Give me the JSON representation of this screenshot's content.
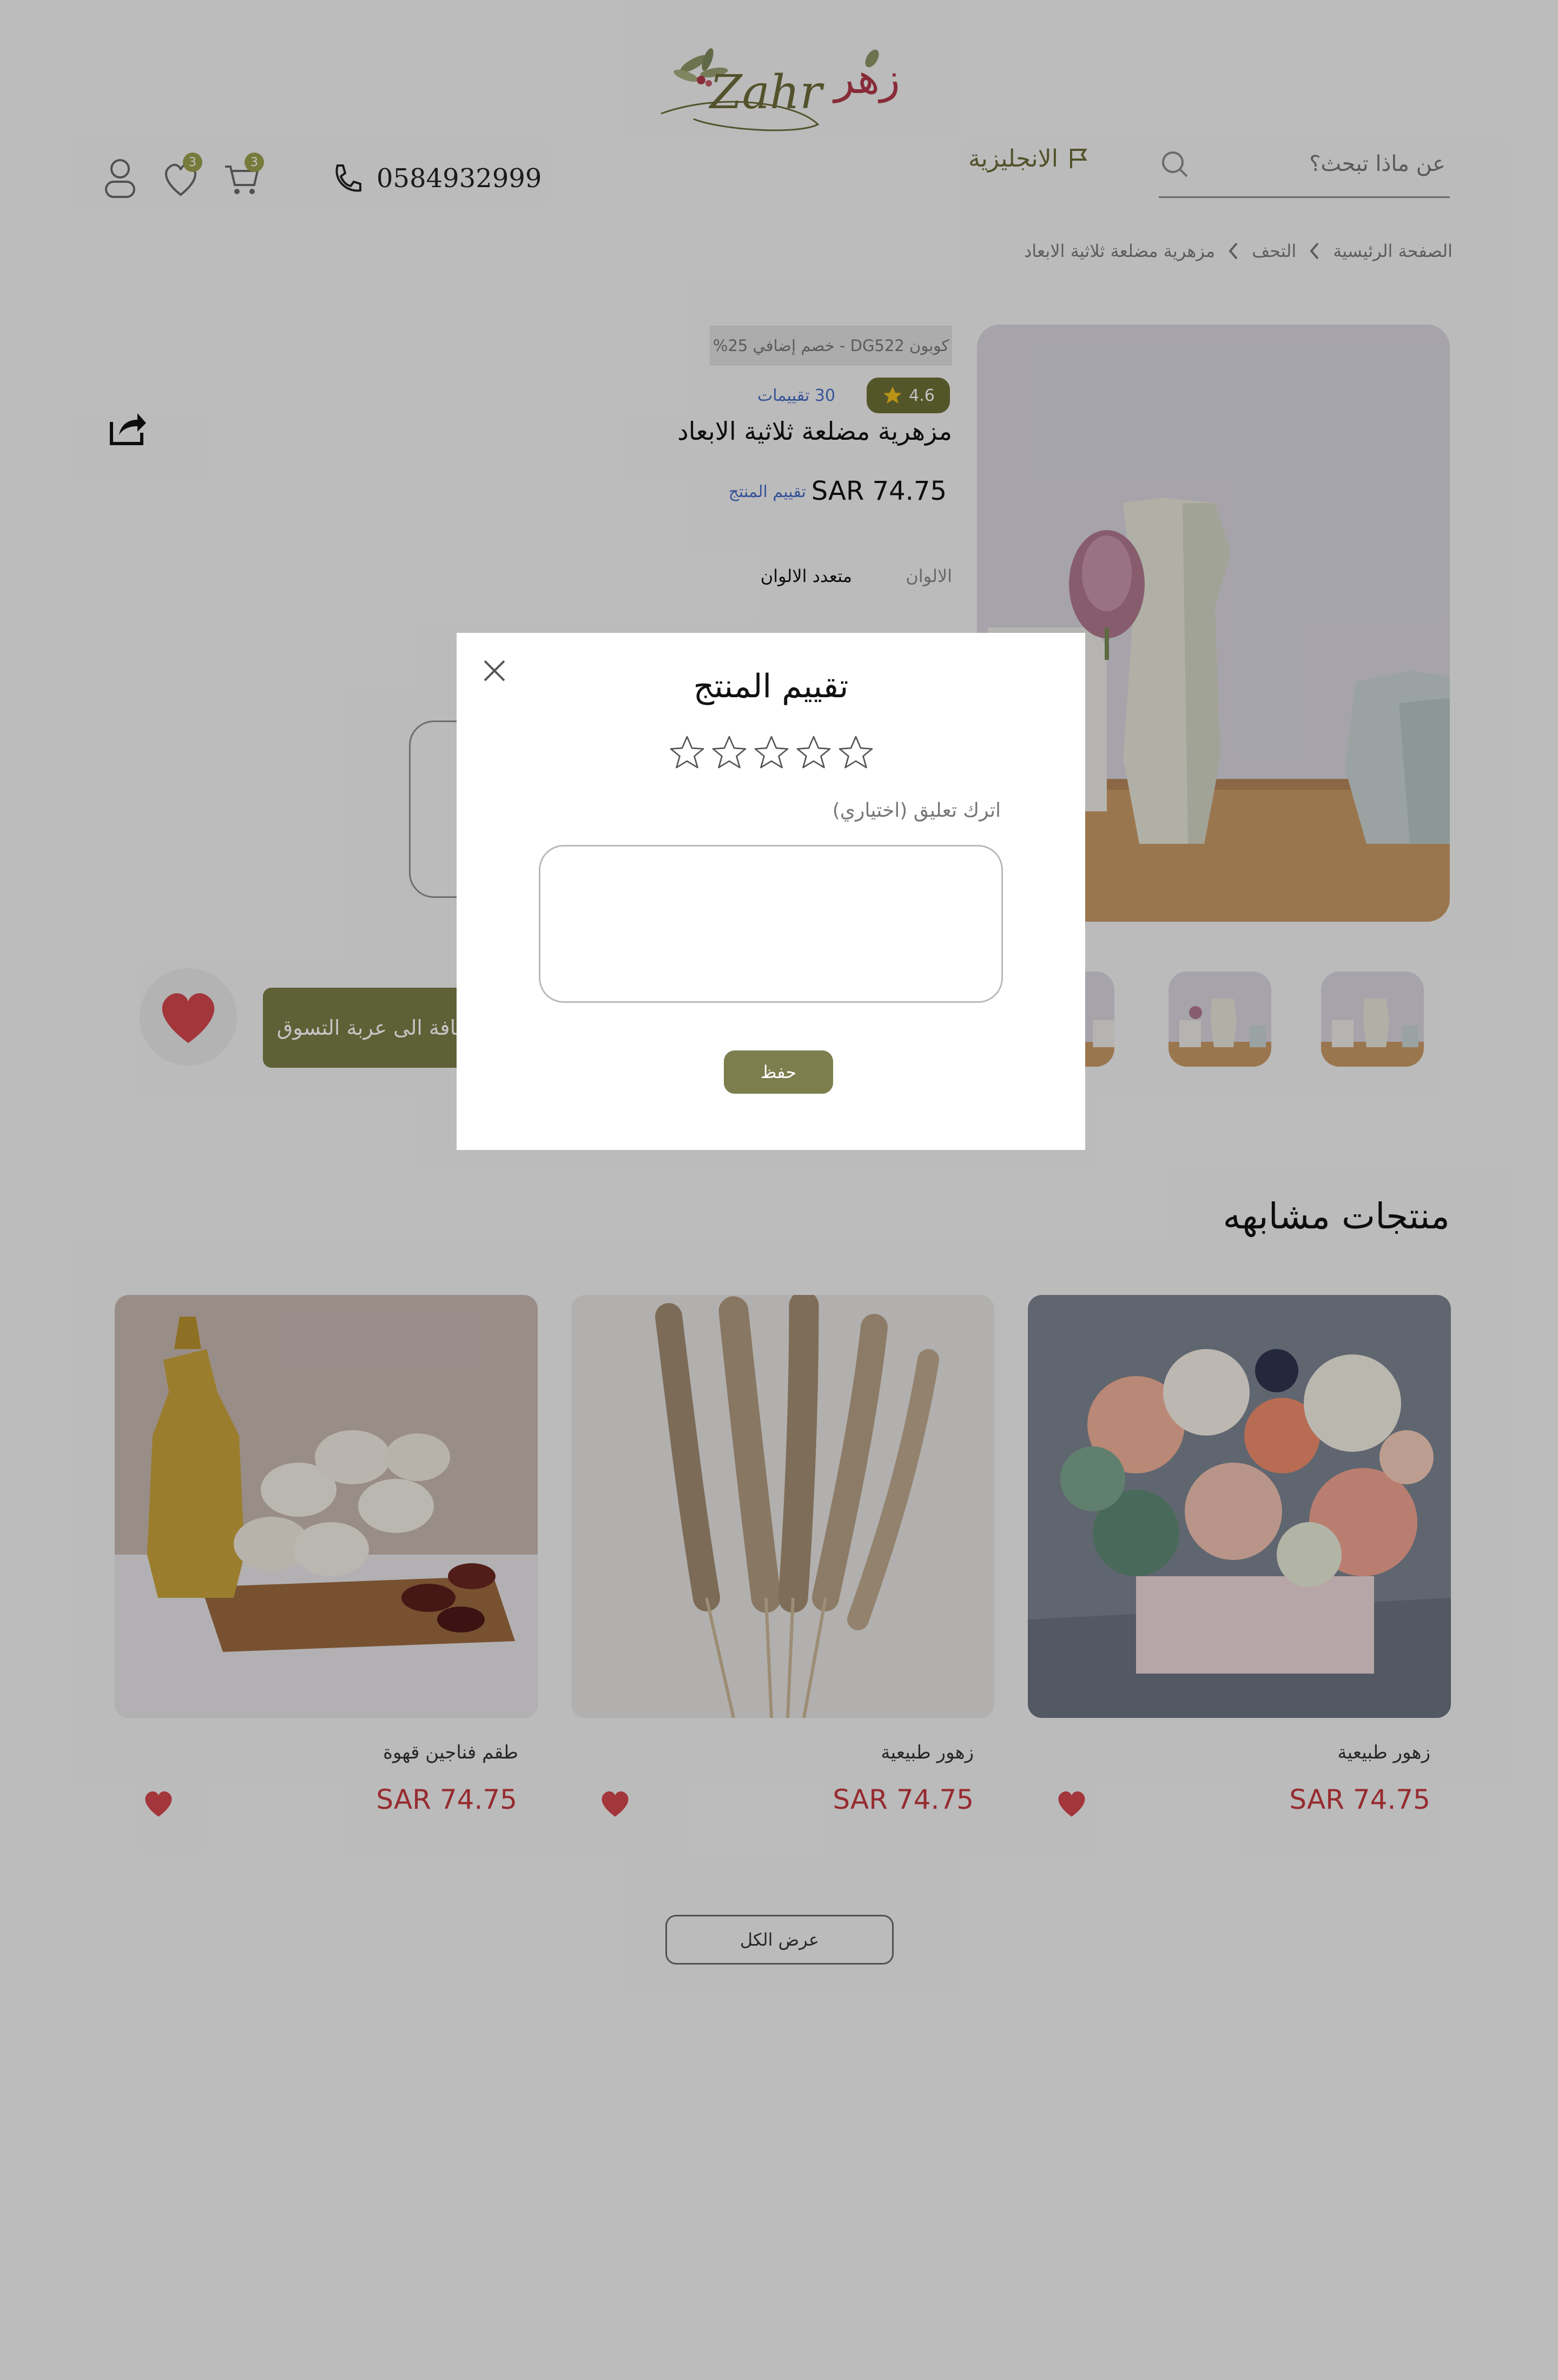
{
  "header": {
    "logo_text_latin": "Zahr",
    "logo_text_arabic": "زهر",
    "search_placeholder": "عن ماذا تبحث؟",
    "language_label": "الانجليزية",
    "phone": "0584932999",
    "wishlist_count": "3",
    "cart_count": "3",
    "icons": [
      "search-icon",
      "flag-icon",
      "phone-icon",
      "cart-icon",
      "heart-icon",
      "user-icon"
    ]
  },
  "breadcrumb": {
    "items": [
      "الصفحة الرئيسية",
      "التحف",
      "مزهرية مضلعة ثلاثية الابعاد"
    ]
  },
  "product": {
    "coupon": "كوبون DG522 - خصم إضافي 25%",
    "rating": "4.6",
    "reviews": "30 تقييمات",
    "title": "مزهرية مضلعة ثلاثية الابعاد",
    "price": "SAR 74.75",
    "rate_link": "تقييم المنتج",
    "colors_label": "الالوان",
    "colors_value": "متعدد الالوان",
    "add_to_cart": "إضافة الى عربة التسوق"
  },
  "similar": {
    "title": "منتجات مشابهه",
    "items": [
      {
        "name": "زهور طبيعية",
        "price": "SAR 74.75"
      },
      {
        "name": "زهور طبيعية",
        "price": "SAR 74.75"
      },
      {
        "name": "طقم فناجين قهوة",
        "price": "SAR 74.75"
      }
    ],
    "view_all": "عرض الكل"
  },
  "modal": {
    "title": "تقييم المنتج",
    "stars_total": 5,
    "stars_selected": 0,
    "comment_label": "اترك تعليق (اختياري)",
    "comment_value": "",
    "save": "حفظ"
  },
  "colors": {
    "accent": "#7b7d46",
    "price_red": "#c4383e",
    "link_blue": "#4a6cc8",
    "logo_red": "#b03a4a"
  }
}
